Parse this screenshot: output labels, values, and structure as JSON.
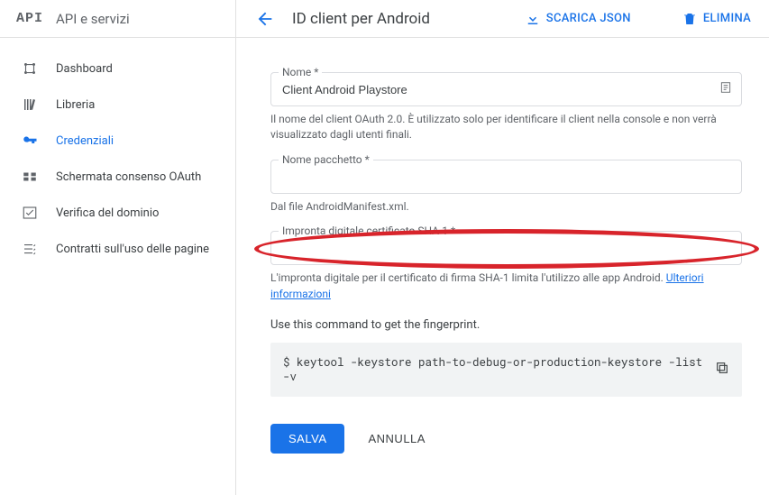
{
  "sidebar": {
    "logo": "API",
    "title": "API e servizi",
    "items": [
      {
        "label": "Dashboard"
      },
      {
        "label": "Libreria"
      },
      {
        "label": "Credenziali"
      },
      {
        "label": "Schermata consenso OAuth"
      },
      {
        "label": "Verifica del dominio"
      },
      {
        "label": "Contratti sull'uso delle pagine"
      }
    ]
  },
  "topbar": {
    "title": "ID client per Android",
    "download": "SCARICA JSON",
    "delete": "ELIMINA"
  },
  "form": {
    "name_label": "Nome *",
    "name_value": "Client Android Playstore",
    "name_helper": "Il nome del client OAuth 2.0. È utilizzato solo per identificare il client nella console e non verrà visualizzato dagli utenti finali.",
    "pkg_label": "Nome pacchetto *",
    "pkg_value": "",
    "pkg_helper": "Dal file AndroidManifest.xml.",
    "sha_label": "Impronta digitale certificato SHA-1 *",
    "sha_value": "",
    "sha_helper_text": "L'impronta digitale per il certificato di firma SHA-1 limita l'utilizzo alle app Android.",
    "sha_helper_link": "Ulteriori informazioni",
    "cmd_hint": "Use this command to get the fingerprint.",
    "cmd_text": "$ keytool -keystore path-to-debug-or-production-keystore -list -v"
  },
  "actions": {
    "save": "SALVA",
    "cancel": "ANNULLA"
  }
}
